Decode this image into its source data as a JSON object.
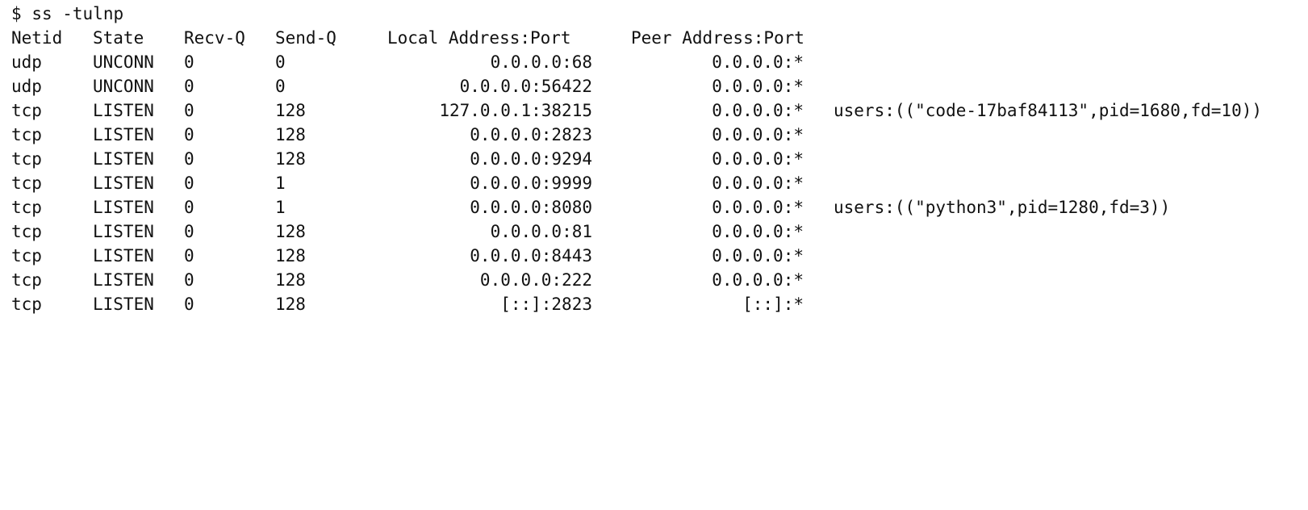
{
  "terminal": {
    "prompt": "$",
    "command": "ss -tulnp"
  },
  "header": {
    "netid": "Netid",
    "state": "State",
    "recvq": "Recv-Q",
    "sendq": "Send-Q",
    "local": "Local Address:Port",
    "peer": "Peer Address:Port"
  },
  "rows": [
    {
      "netid": "udp",
      "state": "UNCONN",
      "recvq": "0",
      "sendq": "0",
      "local": "0.0.0.0:68",
      "peer": "0.0.0.0:*",
      "process": ""
    },
    {
      "netid": "udp",
      "state": "UNCONN",
      "recvq": "0",
      "sendq": "0",
      "local": "0.0.0.0:56422",
      "peer": "0.0.0.0:*",
      "process": ""
    },
    {
      "netid": "tcp",
      "state": "LISTEN",
      "recvq": "0",
      "sendq": "128",
      "local": "127.0.0.1:38215",
      "peer": "0.0.0.0:*",
      "process": "users:((\"code-17baf84113\",pid=1680,fd=10))"
    },
    {
      "netid": "tcp",
      "state": "LISTEN",
      "recvq": "0",
      "sendq": "128",
      "local": "0.0.0.0:2823",
      "peer": "0.0.0.0:*",
      "process": ""
    },
    {
      "netid": "tcp",
      "state": "LISTEN",
      "recvq": "0",
      "sendq": "128",
      "local": "0.0.0.0:9294",
      "peer": "0.0.0.0:*",
      "process": ""
    },
    {
      "netid": "tcp",
      "state": "LISTEN",
      "recvq": "0",
      "sendq": "1",
      "local": "0.0.0.0:9999",
      "peer": "0.0.0.0:*",
      "process": ""
    },
    {
      "netid": "tcp",
      "state": "LISTEN",
      "recvq": "0",
      "sendq": "1",
      "local": "0.0.0.0:8080",
      "peer": "0.0.0.0:*",
      "process": "users:((\"python3\",pid=1280,fd=3))"
    },
    {
      "netid": "tcp",
      "state": "LISTEN",
      "recvq": "0",
      "sendq": "128",
      "local": "0.0.0.0:81",
      "peer": "0.0.0.0:*",
      "process": ""
    },
    {
      "netid": "tcp",
      "state": "LISTEN",
      "recvq": "0",
      "sendq": "128",
      "local": "0.0.0.0:8443",
      "peer": "0.0.0.0:*",
      "process": ""
    },
    {
      "netid": "tcp",
      "state": "LISTEN",
      "recvq": "0",
      "sendq": "128",
      "local": "0.0.0.0:222",
      "peer": "0.0.0.0:*",
      "process": ""
    },
    {
      "netid": "tcp",
      "state": "LISTEN",
      "recvq": "0",
      "sendq": "128",
      "local": "[::]:2823",
      "peer": "[::]:*",
      "process": ""
    }
  ]
}
